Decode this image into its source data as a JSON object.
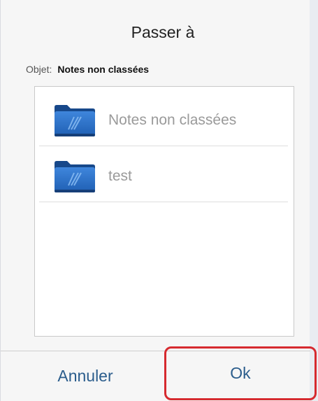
{
  "dialog": {
    "title": "Passer à",
    "subject_label": "Objet:",
    "subject_value": "Notes non classées"
  },
  "folders": [
    {
      "label": "Notes non classées",
      "icon": "folder-icon"
    },
    {
      "label": "test",
      "icon": "folder-icon"
    }
  ],
  "buttons": {
    "cancel_label": "Annuler",
    "ok_label": "Ok"
  },
  "colors": {
    "button_text": "#2b5d8c",
    "highlight": "#d62a2f",
    "folder_blue": "#2a6fc4"
  }
}
